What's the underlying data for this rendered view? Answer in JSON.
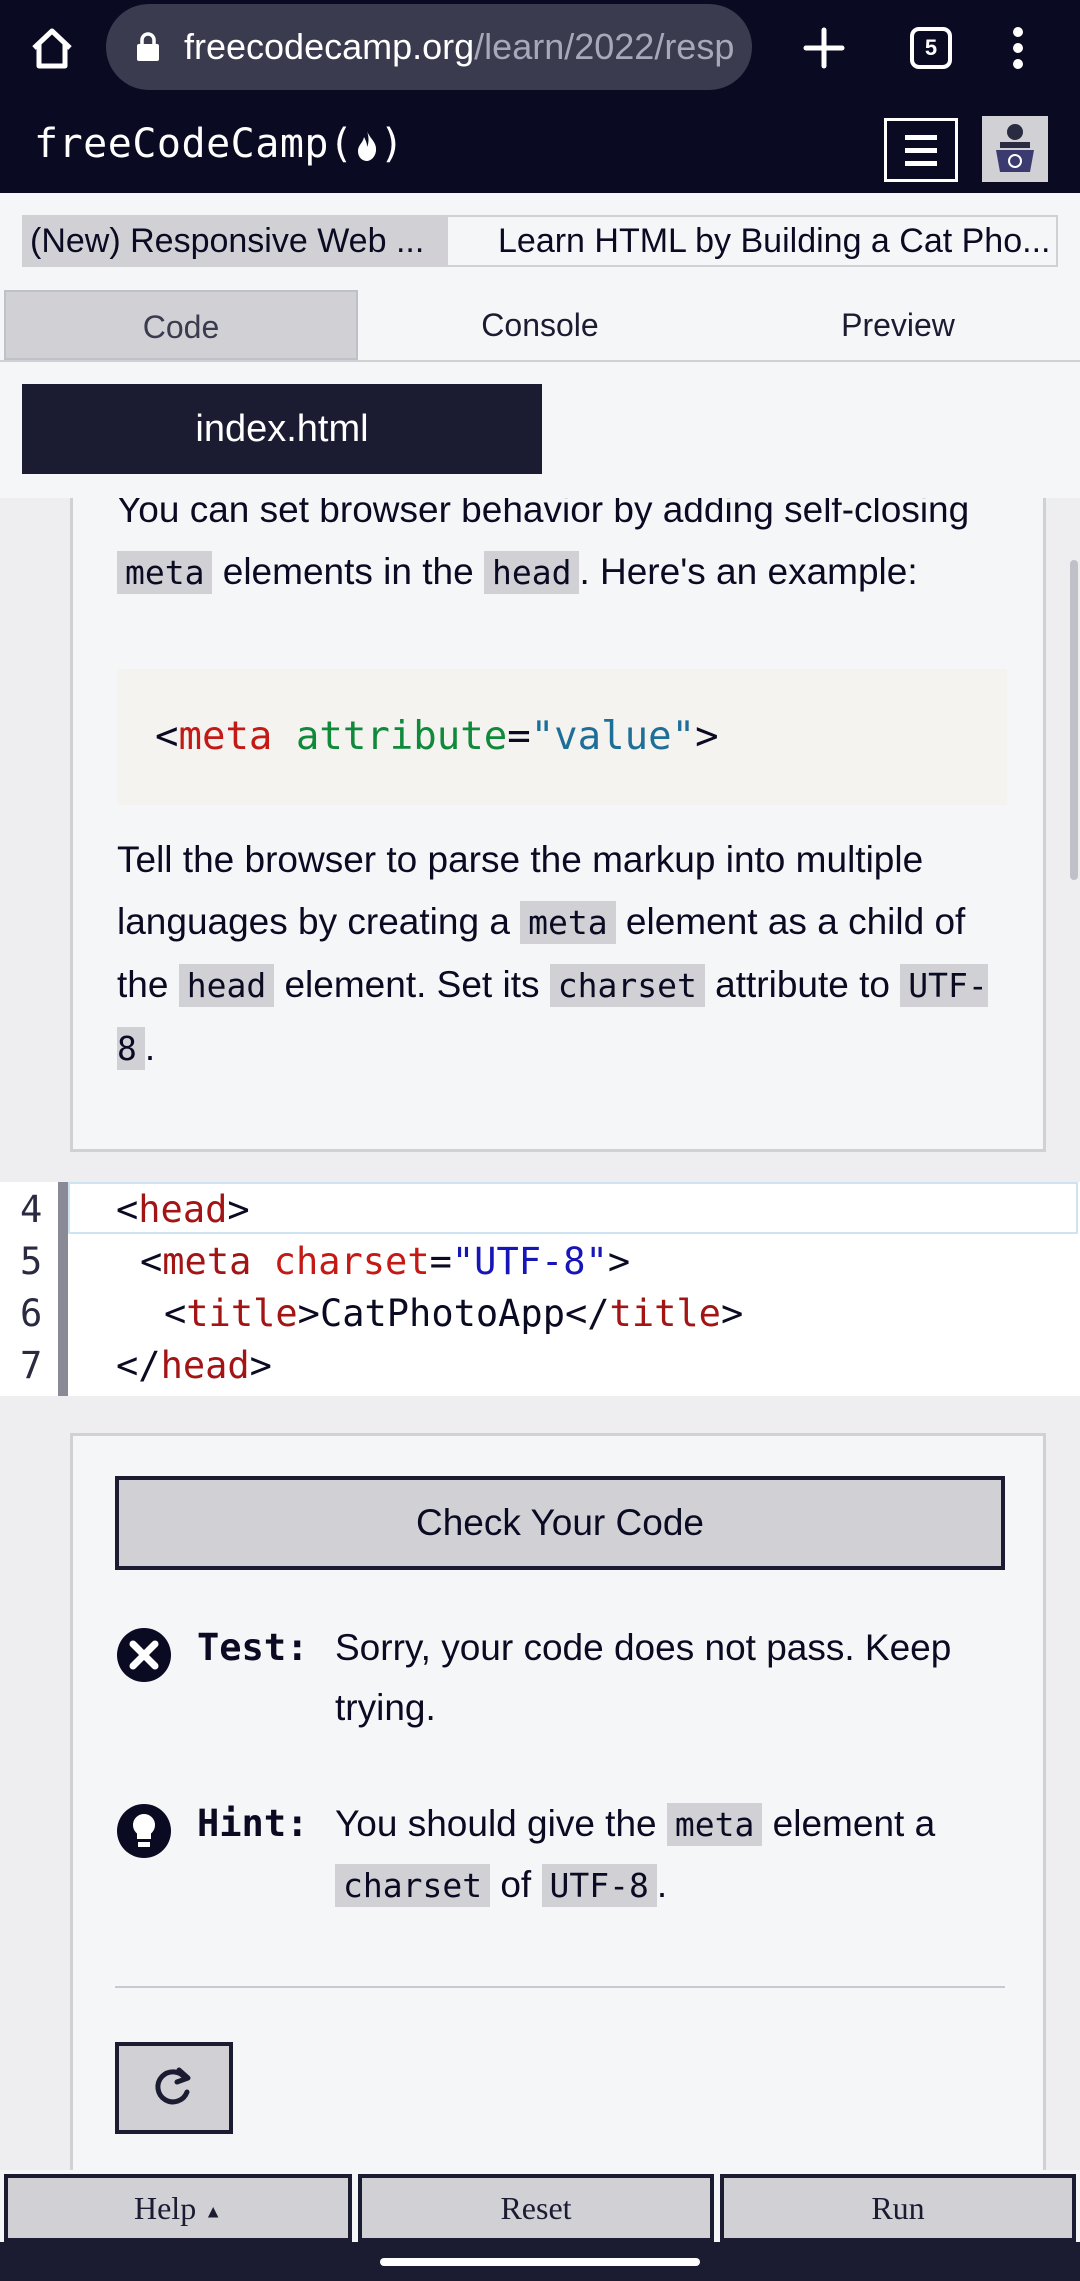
{
  "browser": {
    "url_host": "freecodecamp.org",
    "url_path": "/learn/2022/resp",
    "tab_count": "5"
  },
  "nav": {
    "logo_text": "freeCodeCamp(",
    "logo_close": ")"
  },
  "breadcrumb": {
    "course": "(New) Responsive Web ...",
    "project": "Learn HTML by Building a Cat Pho..."
  },
  "tabs": {
    "code": "Code",
    "console": "Console",
    "preview": "Preview"
  },
  "editor": {
    "file_tab": "index.html",
    "lines": [
      {
        "number": "4"
      },
      {
        "number": "5"
      },
      {
        "number": "6"
      },
      {
        "number": "7"
      }
    ]
  },
  "instructions": {
    "p1_a": "You can set browser behavior by adding self-closing ",
    "p1_code1": "meta",
    "p1_b": " elements in the ",
    "p1_code2": "head",
    "p1_c": ". Here's an example:",
    "example_open": "<",
    "example_tag": "meta",
    "example_attr": "attribute",
    "example_eq": "=",
    "example_val": "\"value\"",
    "example_close": ">",
    "p2_a": "Tell the browser to parse the markup into multiple languages by creating a ",
    "p2_code1": "meta",
    "p2_b": " element as a child of the ",
    "p2_code2": "head",
    "p2_c": " element. Set its ",
    "p2_code3": "charset",
    "p2_d": " attribute to ",
    "p2_code4": "UTF-8",
    "p2_e": "."
  },
  "test_panel": {
    "check_button": "Check Your Code",
    "test_label": "Test:",
    "test_text": "Sorry, your code does not pass. Keep trying.",
    "hint_label": "Hint:",
    "hint_a": "You should give the ",
    "hint_code1": "meta",
    "hint_b": " element a ",
    "hint_code2": "charset",
    "hint_c": " of ",
    "hint_code3": "UTF-8",
    "hint_d": "."
  },
  "actions": {
    "help": "Help",
    "reset": "Reset",
    "run": "Run"
  },
  "colors": {
    "nav_bg": "#0a0a23",
    "panel_bg": "#f5f6f7",
    "button_bg": "#d0d0d5"
  }
}
